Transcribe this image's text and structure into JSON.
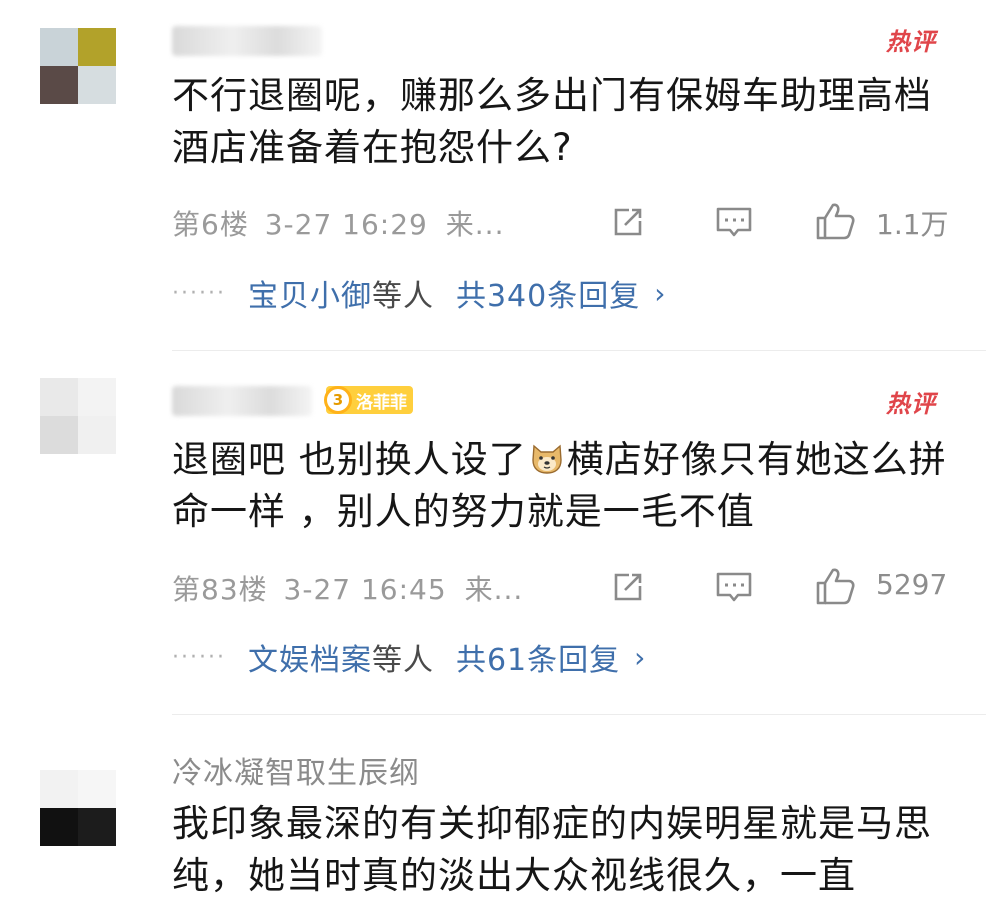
{
  "comments": [
    {
      "username": "",
      "hot_badge": "热评",
      "text": "不行退圈呢，赚那么多出门有保姆车助理高档酒店准备着在抱怨什么?",
      "floor": "第6楼",
      "time": "3-27 16:29",
      "source": "来...",
      "likes": "1.1万",
      "reply_names": "宝贝小御",
      "reply_suffix": "等人",
      "reply_count": "共340条回复",
      "avatar_colors": [
        "#c9d3d8",
        "#b2a22a",
        "#5a4a47",
        "#d6dde0"
      ]
    },
    {
      "username": "",
      "fan_badge_level": "3",
      "fan_badge_text": "洛菲菲",
      "hot_badge": "热评",
      "text_before_emoji": "退圈吧 也别换人设了",
      "emoji": "doge-emoji",
      "text_after_emoji": "横店好像只有她这么拼命一样 ，别人的努力就是一毛不值",
      "floor": "第83楼",
      "time": "3-27 16:45",
      "source": "来...",
      "likes": "5297",
      "reply_names": "文娱档案",
      "reply_suffix": "等人",
      "reply_count": "共61条回复",
      "avatar_colors": [
        "#e9e9e9",
        "#f3f3f3",
        "#dcdcdc",
        "#f0f0f0"
      ]
    },
    {
      "username": "冷冰凝智取生辰纲",
      "text": "我印象最深的有关抑郁症的内娱明星就是马思纯，她当时真的淡出大众视线很久，一直",
      "avatar_colors": [
        "#f2f2f2",
        "#f6f6f6",
        "#111111",
        "#1c1c1c"
      ]
    }
  ],
  "icons": {
    "share": "share-icon",
    "comment": "comment-icon",
    "like": "thumbs-up-icon",
    "chevron": "chevron-right-icon"
  },
  "colors": {
    "hot": "#e0454a",
    "link": "#3f6fab",
    "meta": "#9a9a9a"
  },
  "chevron_glyph": "›"
}
